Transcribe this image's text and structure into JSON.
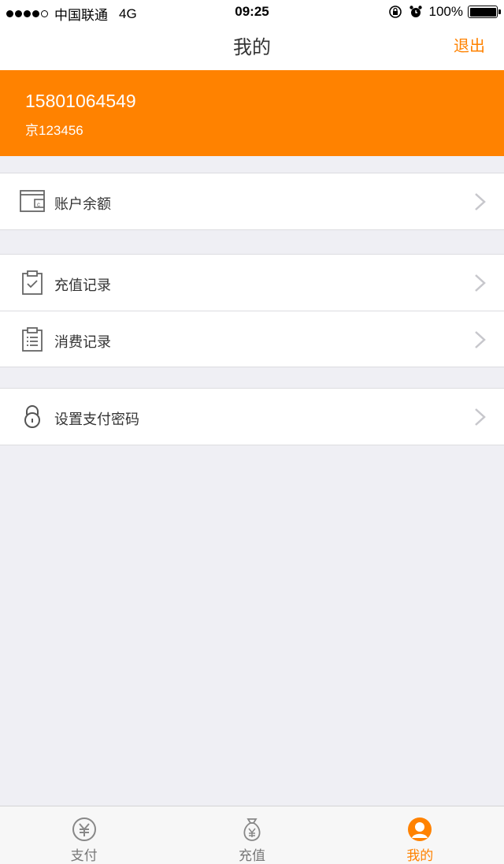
{
  "status_bar": {
    "carrier": "中国联通",
    "network": "4G",
    "time": "09:25",
    "battery": "100%"
  },
  "header": {
    "title": "我的",
    "logout_label": "退出"
  },
  "profile": {
    "phone": "15801064549",
    "plate": "京123456"
  },
  "menu": {
    "balance_label": "账户余额",
    "recharge_records_label": "充值记录",
    "consume_records_label": "消费记录",
    "set_password_label": "设置支付密码"
  },
  "tabs": [
    {
      "label": "支付",
      "icon": "yuan-coin-icon"
    },
    {
      "label": "充值",
      "icon": "money-bag-icon"
    },
    {
      "label": "我的",
      "icon": "user-icon"
    }
  ],
  "colors": {
    "accent": "#ff8200",
    "background": "#efeff4",
    "chevron": "#c7c7cc"
  }
}
